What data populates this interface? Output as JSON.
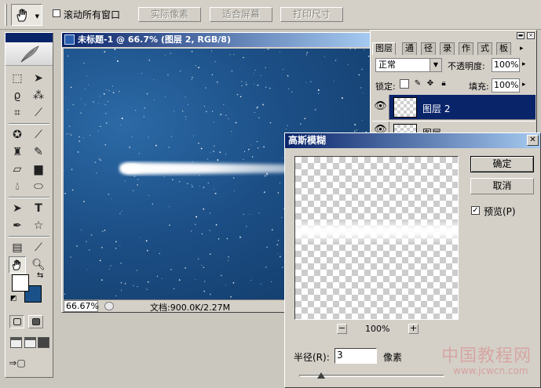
{
  "options_bar": {
    "tool_icon": "hand-icon",
    "scroll_all_label": "滚动所有窗口",
    "scroll_all_checked": false,
    "actual_pixels_label": "实际像素",
    "fit_screen_label": "适合屏幕",
    "print_size_label": "打印尺寸"
  },
  "toolbox": {
    "foreground_color": "#ffffff",
    "background_color": "#1a5188",
    "tools": [
      "marquee-icon",
      "move-icon",
      "lasso-icon",
      "magic-wand-icon",
      "crop-icon",
      "slice-icon",
      "healing-brush-icon",
      "brush-icon",
      "clone-stamp-icon",
      "history-brush-icon",
      "eraser-icon",
      "gradient-icon",
      "blur-icon",
      "dodge-icon",
      "path-select-icon",
      "type-icon",
      "pen-icon",
      "shape-icon",
      "notes-icon",
      "eyedropper-icon",
      "hand-icon",
      "zoom-icon"
    ]
  },
  "document": {
    "title": "未标题-1 @ 66.7% (图层 2, RGB/8)",
    "zoom": "66.67%",
    "doc_size": "文档:900.0K/2.27M",
    "canvas_color": "#1c4f86"
  },
  "layers_panel": {
    "tabs": [
      "图层",
      "通",
      "径",
      "录",
      "作",
      "式",
      "板"
    ],
    "blend_mode": "正常",
    "opacity_label": "不透明度:",
    "opacity": "100%",
    "lock_label": "锁定:",
    "fill_label": "填充:",
    "fill": "100%",
    "layers": [
      {
        "name": "图层 2",
        "selected": true
      },
      {
        "name": "图层",
        "selected": false
      }
    ]
  },
  "blur_dialog": {
    "title": "高斯模糊",
    "ok_label": "确定",
    "cancel_label": "取消",
    "preview_label": "预览(P)",
    "preview_checked": true,
    "zoom_out": "−",
    "zoom_value": "100%",
    "zoom_in": "+",
    "radius_label": "半径(R):",
    "radius_value": "3",
    "radius_unit": "像素",
    "radius_slider_fraction": 0.15
  },
  "watermark": {
    "text": "中国教程网",
    "url": "www.jcwcn.com"
  }
}
